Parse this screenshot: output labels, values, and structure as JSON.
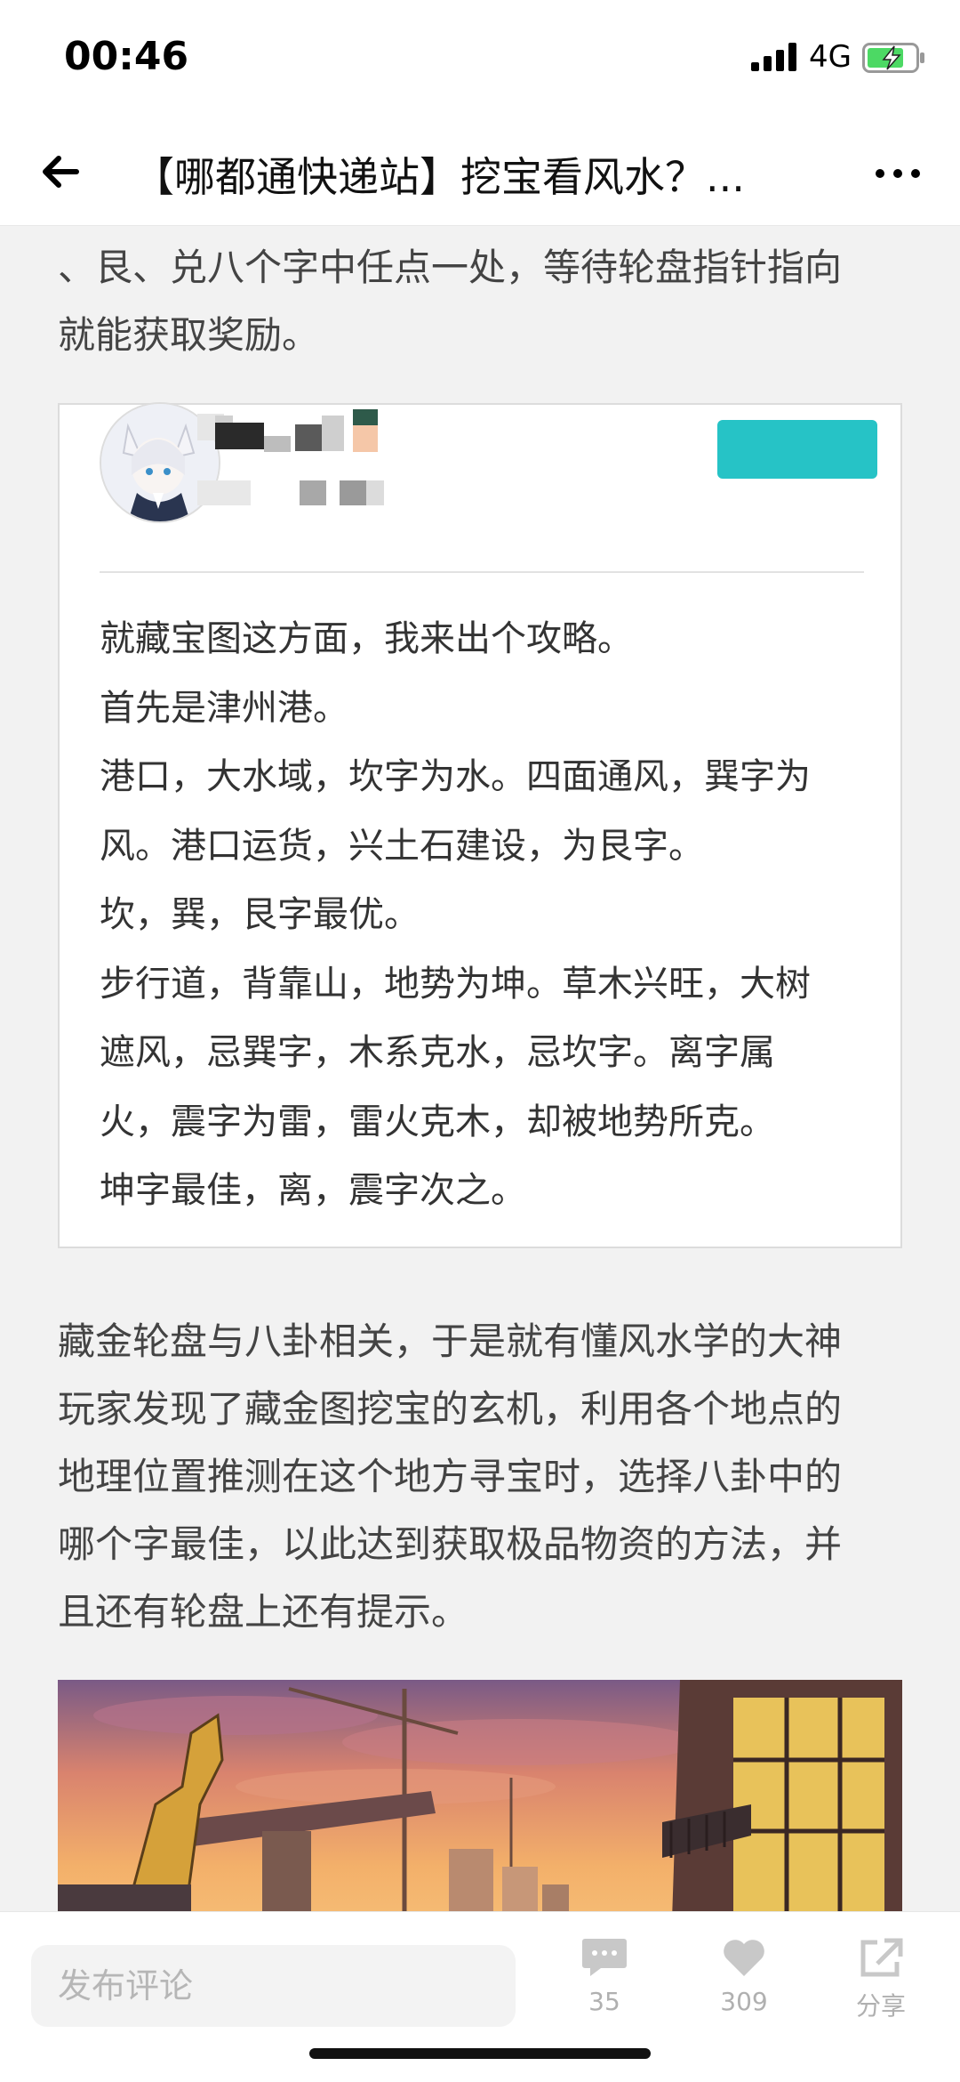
{
  "status": {
    "time": "00:46",
    "network": "4G"
  },
  "nav": {
    "title": "【哪都通快递站】挖宝看风水？..."
  },
  "article": {
    "intro_lines": [
      "、艮、兑八个字中任点一处，等待轮盘指针指向",
      "就能获取奖励。"
    ],
    "quote_lines": [
      "就藏宝图这方面，我来出个攻略。",
      "首先是津州港。",
      "港口，大水域，坎字为水。四面通风，巽字为",
      "风。港口运货，兴土石建设，为艮字。",
      "坎，巽，艮字最优。",
      "步行道，背靠山，地势为坤。草木兴旺，大树",
      "遮风，忌巽字，木系克水，忌坎字。离字属",
      "火，震字为雷，雷火克木，却被地势所克。",
      "坤字最佳，离，震字次之。"
    ],
    "body_lines": [
      "藏金轮盘与八卦相关，于是就有懂风水学的大神",
      "玩家发现了藏金图挖宝的玄机，利用各个地点的",
      "地理位置推测在这个地方寻宝时，选择八卦中的",
      "哪个字最佳，以此达到获取极品物资的方法，并",
      "且还有轮盘上还有提示。"
    ]
  },
  "bottom": {
    "comment_placeholder": "发布评论",
    "comment_count": "35",
    "like_count": "309",
    "share_label": "分享"
  },
  "colors": {
    "accent_cyan": "#26c3c6",
    "battery_green": "#4cd964"
  }
}
